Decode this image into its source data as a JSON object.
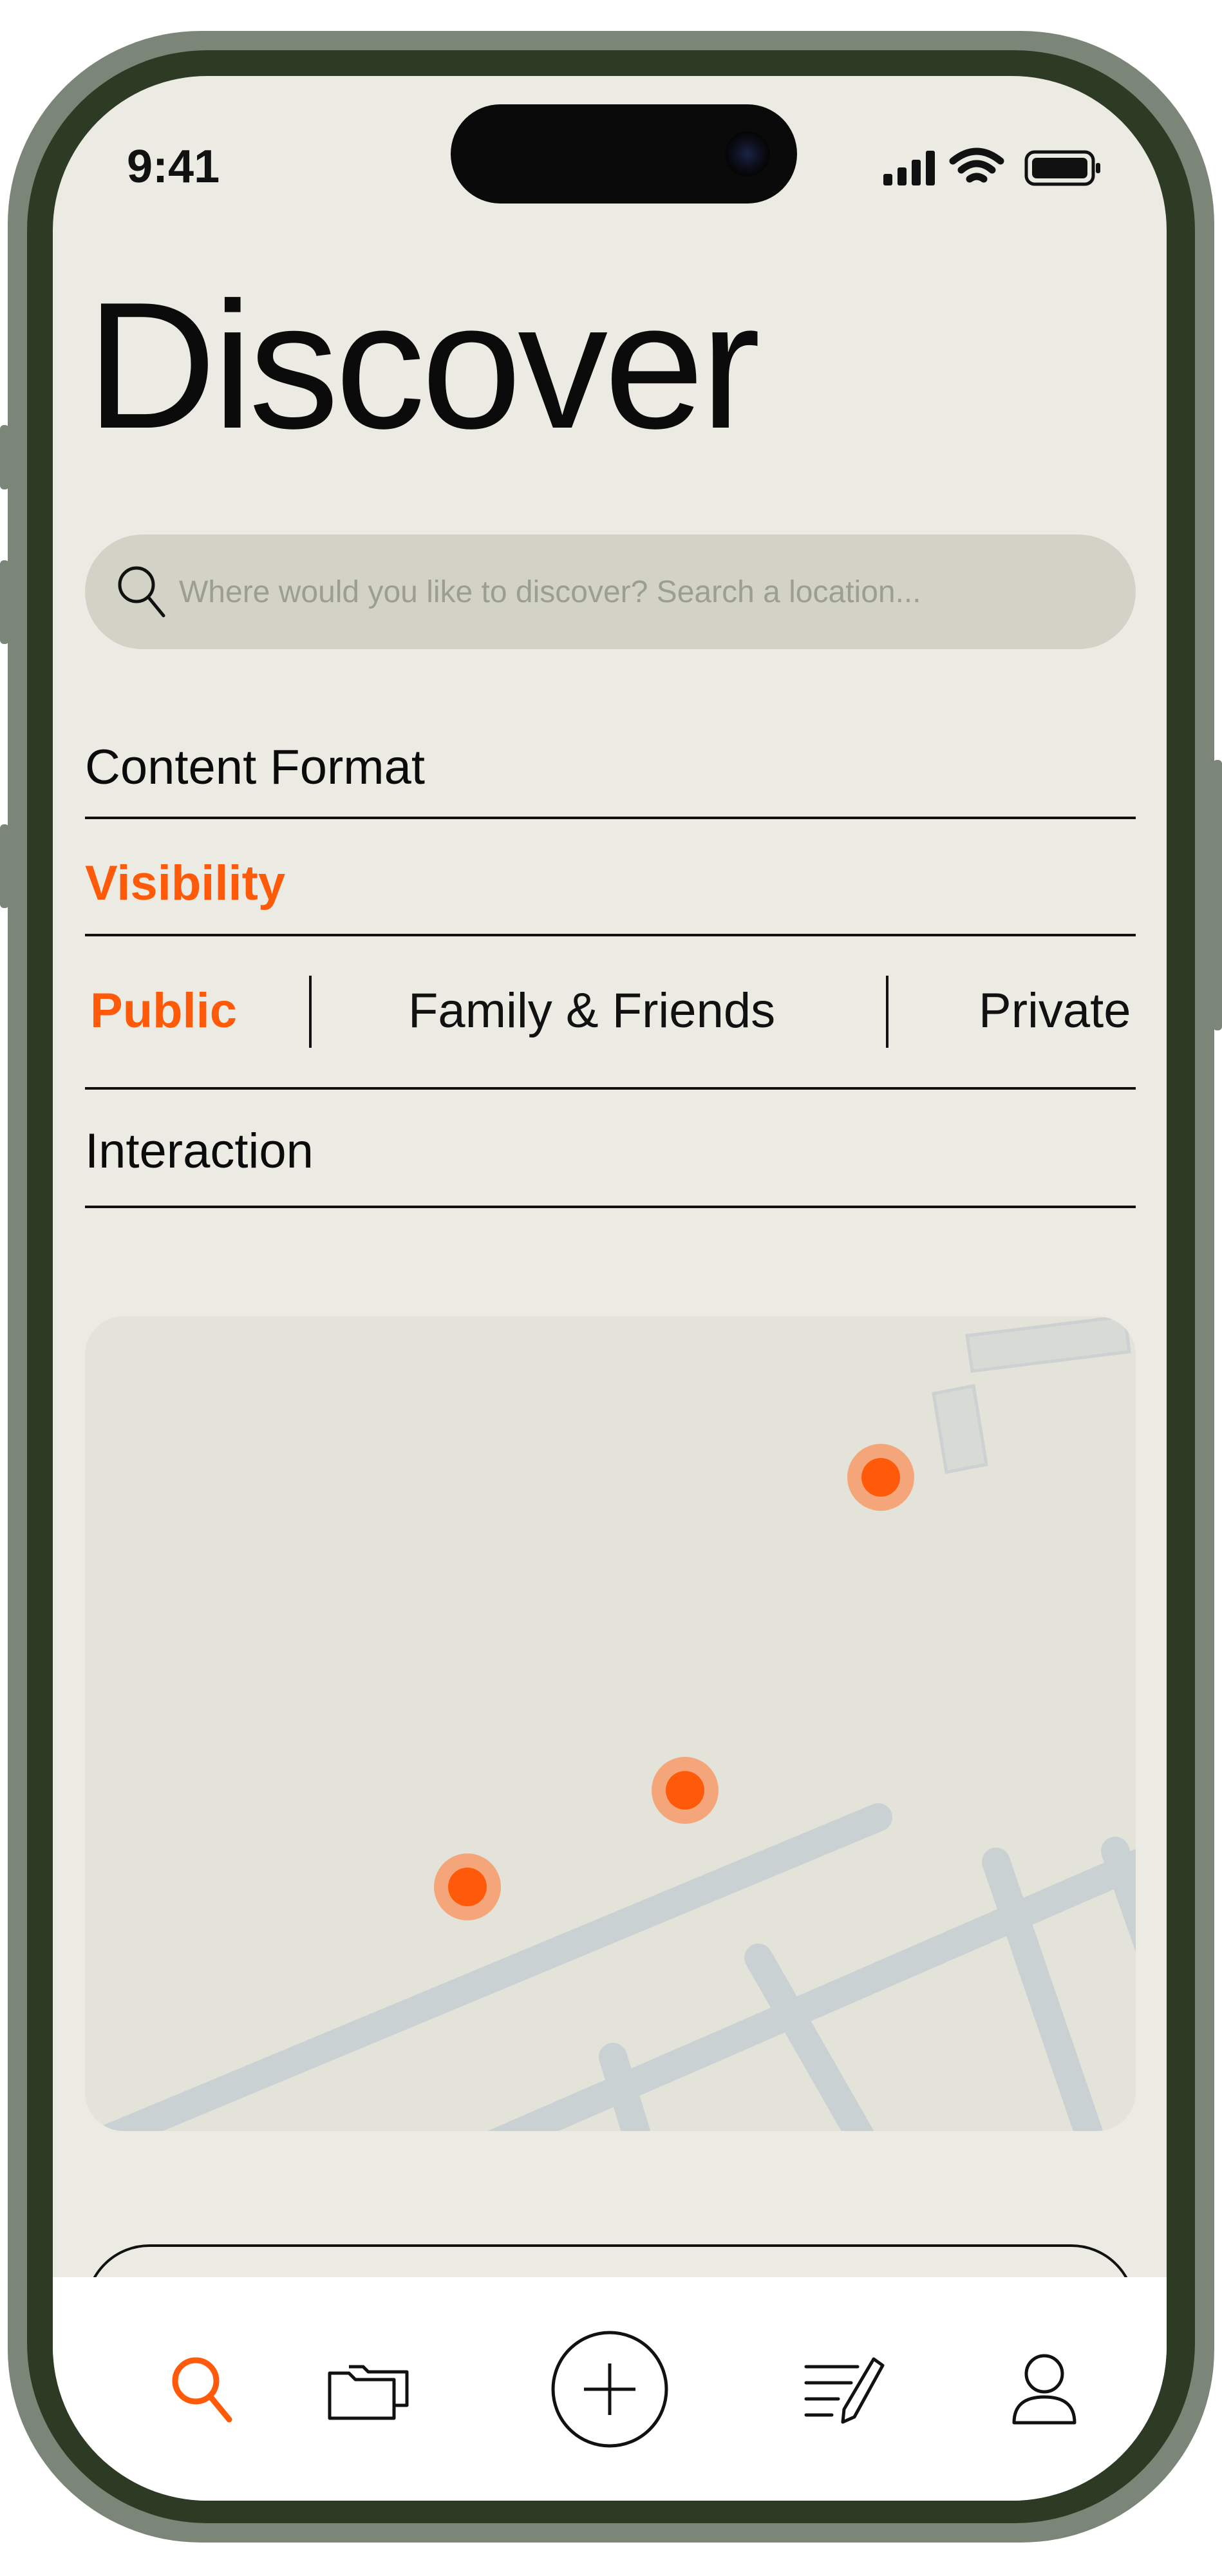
{
  "status_bar": {
    "time": "9:41"
  },
  "header": {
    "title": "Discover"
  },
  "search": {
    "placeholder": "Where would you like to discover? Search a location..."
  },
  "filters": {
    "content_format": "Content Format",
    "visibility": "Visibility",
    "visibility_options": [
      "Public",
      "Family & Friends",
      "Private"
    ],
    "visibility_selected": "Public",
    "interaction": "Interaction"
  },
  "map": {
    "pins": 3
  },
  "tab_bar": {
    "items": [
      {
        "name": "search",
        "icon": "search-icon",
        "active": true
      },
      {
        "name": "folders",
        "icon": "folders-icon",
        "active": false
      },
      {
        "name": "add",
        "icon": "plus-circle-icon",
        "active": false
      },
      {
        "name": "notes",
        "icon": "edit-list-icon",
        "active": false
      },
      {
        "name": "profile",
        "icon": "user-icon",
        "active": false
      }
    ]
  },
  "colors": {
    "accent": "#ff5a0a",
    "background": "#ebebe3",
    "search_bg": "#d2d3c6",
    "map_bg": "#e3e3da",
    "frame": "#2d3b25"
  }
}
